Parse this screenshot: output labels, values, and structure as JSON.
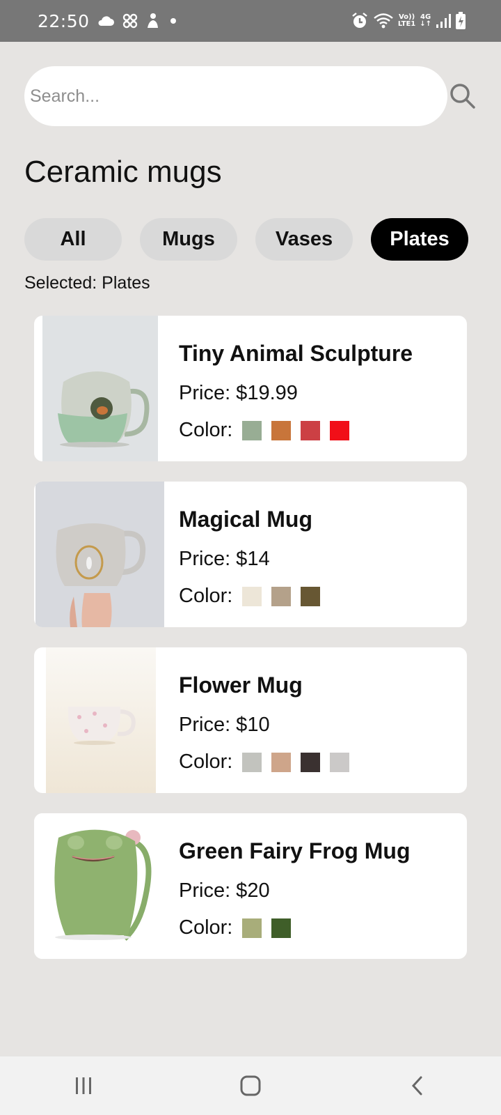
{
  "status_bar": {
    "time": "22:50",
    "volte_label": "Vo))",
    "lte_label": "LTE1",
    "network_label": "4G",
    "icons_left": [
      "cloud-icon",
      "fan-icon",
      "person-icon",
      "dot-icon"
    ],
    "icons_right": [
      "alarm-icon",
      "wifi-icon",
      "signal-icon",
      "battery-icon"
    ]
  },
  "search": {
    "placeholder": "Search...",
    "value": ""
  },
  "page_title": "Ceramic mugs",
  "filters": {
    "chips": [
      {
        "label": "All"
      },
      {
        "label": "Mugs"
      },
      {
        "label": "Vases"
      },
      {
        "label": "Plates"
      }
    ],
    "active": "Plates",
    "selected_text": "Selected: Plates"
  },
  "products": [
    {
      "name": "Tiny Animal Sculpture",
      "price": "Price: $19.99",
      "color_label": "Color:",
      "colors": [
        "#98ad94",
        "#c8753a",
        "#cc4044",
        "#f10f18"
      ]
    },
    {
      "name": "Magical Mug",
      "price": "Price: $14",
      "color_label": "Color:",
      "colors": [
        "#ede6d8",
        "#b4a18a",
        "#675733"
      ]
    },
    {
      "name": "Flower Mug",
      "price": "Price: $10",
      "color_label": "Color:",
      "colors": [
        "#c2c3be",
        "#cea58a",
        "#3a3130",
        "#cbc9c8"
      ]
    },
    {
      "name": "Green Fairy Frog Mug",
      "price": "Price: $20",
      "color_label": "Color:",
      "colors": [
        "#a8ad7a",
        "#3f5e29"
      ]
    }
  ],
  "nav": {
    "items": [
      "recents-icon",
      "home-icon",
      "back-icon"
    ]
  },
  "colors": {
    "background": "#e6e4e2",
    "status_bar": "#777777",
    "active_chip": "#000000",
    "chip": "#d9d9d9"
  }
}
